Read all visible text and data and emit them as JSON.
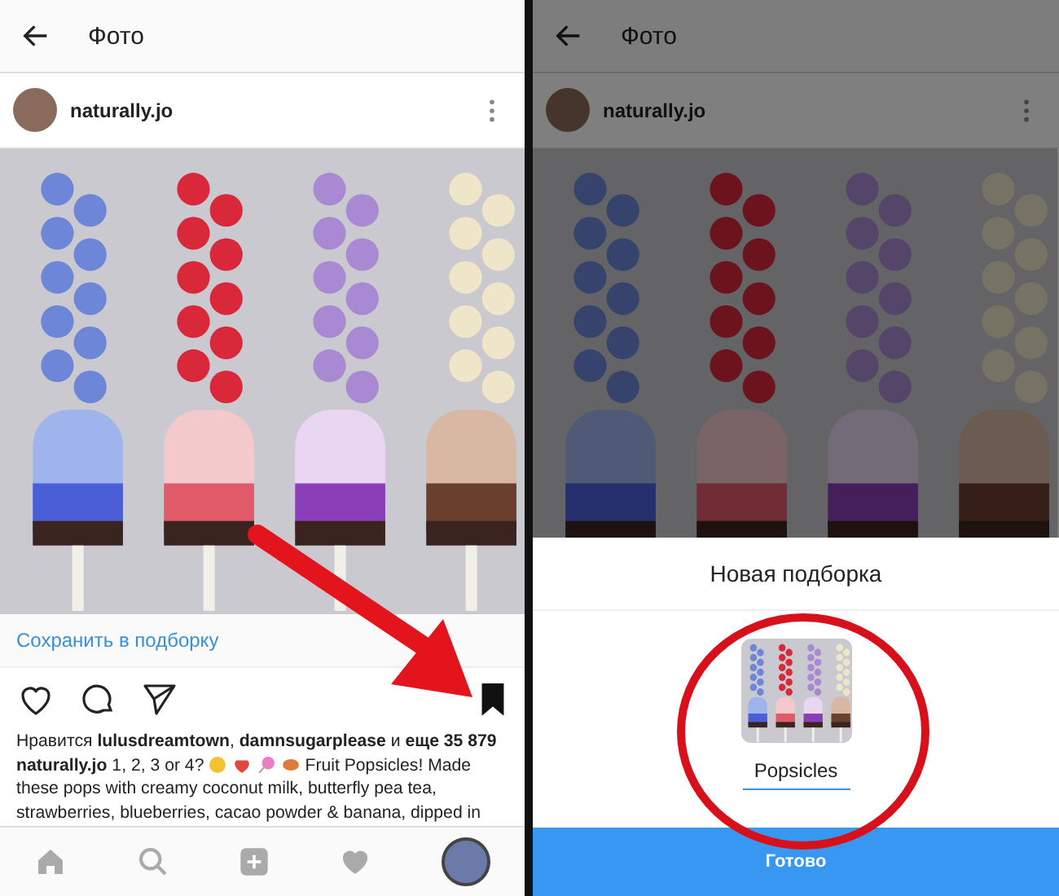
{
  "left_screen": {
    "toolbar": {
      "title": "Фото"
    },
    "post": {
      "username": "naturally.jo",
      "save_prompt": "Сохранить в подборку",
      "saved": true,
      "likes": "Нравится **lulusdreamtown**, **damnsugarplease** и **еще 35 879**",
      "caption_start": "**naturally.jo** 1, 2, 3 or 4?",
      "caption_rest_first_line": "Fruit Popsicles! Made",
      "caption_more": "these pops with creamy coconut milk, butterfly pea tea, strawberries, blueberries, cacao powder & banana, dipped in"
    }
  },
  "right_screen": {
    "toolbar": {
      "title": "Фото"
    },
    "post": {
      "username": "naturally.jo"
    },
    "sheet": {
      "title": "Новая подборка",
      "collection_name": "Popsicles",
      "done_button": "Готово"
    }
  }
}
